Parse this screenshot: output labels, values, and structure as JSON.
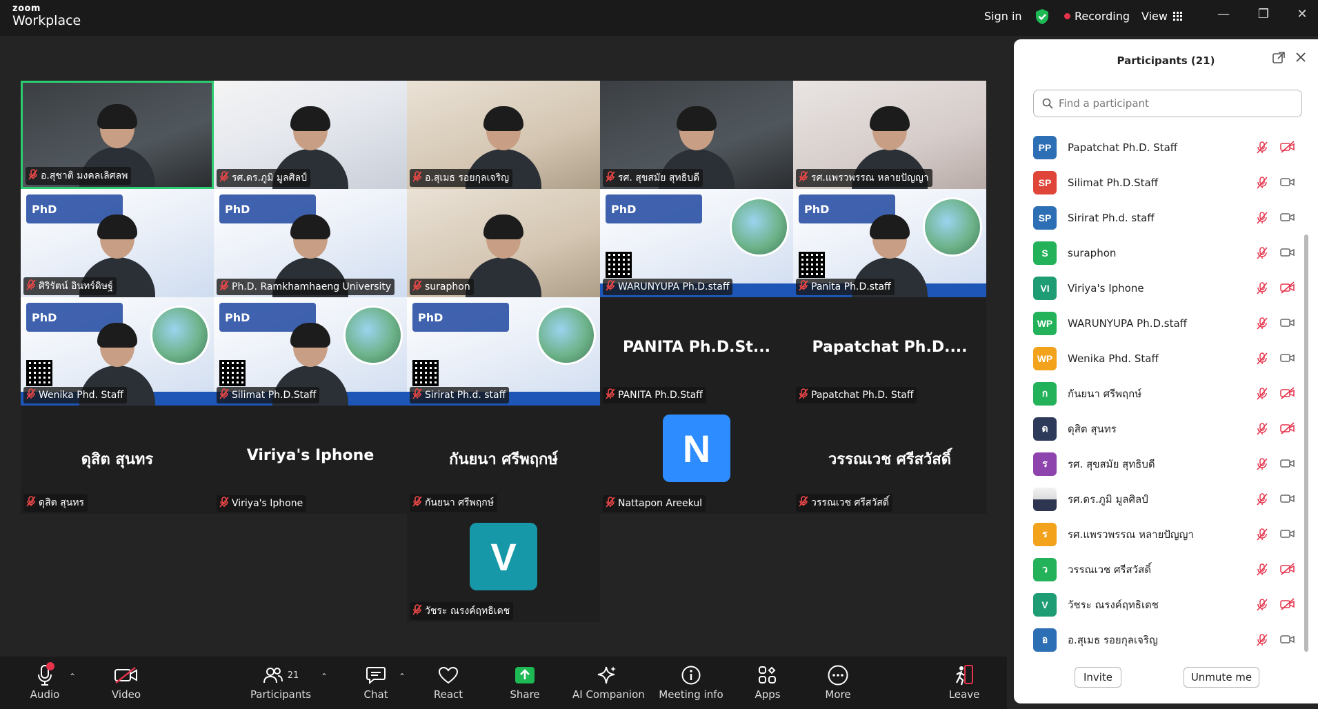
{
  "app": {
    "logo_line1": "zoom",
    "logo_line2": "Workplace"
  },
  "topbar": {
    "sign_in": "Sign in",
    "recording": "Recording",
    "view": "View"
  },
  "colors": {
    "accent": "#2d8cff",
    "active_speaker": "#2ecc71",
    "mic_off": "#f04848",
    "recording_dot": "#e5334b",
    "shield": "#1db954"
  },
  "tiles": [
    {
      "name": "อ.สุชาติ มงคลเลิศลพ",
      "video": true,
      "active": true,
      "kind": "office"
    },
    {
      "name": "รศ.ดร.ภูมิ มูลศิลป์",
      "video": true,
      "kind": "slide"
    },
    {
      "name": "อ.สุเมธ รอยกุลเจริญ",
      "video": true,
      "kind": "plain"
    },
    {
      "name": "รศ. สุขสมัย สุทธิบดี",
      "video": true,
      "kind": "dark"
    },
    {
      "name": "รศ.แพรวพรรณ หลายปัญญา",
      "video": true,
      "kind": "woman"
    },
    {
      "name": "ศิริรัตน์ อินทร์ดิษฐ์",
      "video": true,
      "kind": "phd"
    },
    {
      "name": "Ph.D. Ramkhamhaeng University",
      "video": true,
      "kind": "phd"
    },
    {
      "name": "suraphon",
      "video": true,
      "kind": "plain"
    },
    {
      "name": "WARUNYUPA Ph.D.staff",
      "video": true,
      "kind": "poster-narrow"
    },
    {
      "name": "Panita Ph.D.staff",
      "video": true,
      "kind": "poster"
    },
    {
      "name": "Wenika Phd. Staff",
      "video": true,
      "kind": "poster"
    },
    {
      "name": "Silimat Ph.D.Staff",
      "video": true,
      "kind": "poster"
    },
    {
      "name": "Sirirat Ph.d. staff",
      "video": true,
      "kind": "poster-narrow"
    },
    {
      "name": "PANITA Ph.D.Staff",
      "video": false,
      "big": "PANITA  Ph.D.St..."
    },
    {
      "name": "Papatchat Ph.D. Staff",
      "video": false,
      "big": "Papatchat  Ph.D...."
    },
    {
      "name": "ดุสิต  สุนทร",
      "video": false,
      "big": "ดุสิต  สุนทร"
    },
    {
      "name": "Viriya's Iphone",
      "video": false,
      "big": "Viriya's Iphone"
    },
    {
      "name": "กันยนา ศรีพฤกษ์",
      "video": false,
      "big": "กันยนา ศรีพฤกษ์"
    },
    {
      "name": "Nattapon Areekul",
      "video": false,
      "avatar": "N",
      "avatar_color": "#2d8cff"
    },
    {
      "name": "วรรณเวช ศรีสวัสดิ์",
      "video": false,
      "big": "วรรณเวช ศรีสวัสดิ์"
    },
    {
      "name": "วัชระ ณรงค์ฤทธิเดช",
      "video": false,
      "avatar": "V",
      "avatar_color": "#1798a8"
    }
  ],
  "panel": {
    "title": "Participants (21)",
    "search_placeholder": "Find a participant",
    "invite": "Invite",
    "unmute_me": "Unmute me",
    "participants": [
      {
        "initials": "PP",
        "name": "Papatchat Ph.D. Staff",
        "color": "#2d6fb5",
        "video_off": true
      },
      {
        "initials": "SP",
        "name": "Silimat Ph.D.Staff",
        "color": "#e0453a",
        "video_off": false
      },
      {
        "initials": "SP",
        "name": "Sirirat Ph.d. staff",
        "color": "#2d6fb5",
        "video_off": false
      },
      {
        "initials": "S",
        "name": "suraphon",
        "color": "#23b25a",
        "video_off": false
      },
      {
        "initials": "VI",
        "name": "Viriya's Iphone",
        "color": "#1e9c73",
        "video_off": true
      },
      {
        "initials": "WP",
        "name": "WARUNYUPA Ph.D.staff",
        "color": "#23b25a",
        "video_off": false
      },
      {
        "initials": "WP",
        "name": "Wenika Phd. Staff",
        "color": "#f2a21b",
        "video_off": false
      },
      {
        "initials": "ก",
        "name": "กันยนา ศรีพฤกษ์",
        "color": "#23b25a",
        "video_off": true
      },
      {
        "initials": "ด",
        "name": "ดุสิต  สุนทร",
        "color": "#2d3a5a",
        "video_off": true
      },
      {
        "initials": "ร",
        "name": "รศ. สุขสมัย สุทธิบดี",
        "color": "#8e44ad",
        "video_off": false
      },
      {
        "initials": "",
        "name": "รศ.ดร.ภูมิ มูลศิลป์",
        "color": "photo",
        "video_off": false
      },
      {
        "initials": "ร",
        "name": "รศ.แพรวพรรณ หลายปัญญา",
        "color": "#f2a21b",
        "video_off": false
      },
      {
        "initials": "ว",
        "name": "วรรณเวช ศรีสวัสดิ์",
        "color": "#23b25a",
        "video_off": true
      },
      {
        "initials": "V",
        "name": "วัชระ ณรงค์ฤทธิเดช",
        "color": "#1e9c73",
        "video_off": true
      },
      {
        "initials": "อ",
        "name": "อ.สุเมธ รอยกุลเจริญ",
        "color": "#2d6fb5",
        "video_off": false
      }
    ]
  },
  "toolbar": {
    "audio": "Audio",
    "video": "Video",
    "participants": "Participants",
    "participants_count": "21",
    "chat": "Chat",
    "react": "React",
    "share": "Share",
    "ai_companion": "AI Companion",
    "meeting_info": "Meeting info",
    "apps": "Apps",
    "more": "More",
    "leave": "Leave"
  }
}
